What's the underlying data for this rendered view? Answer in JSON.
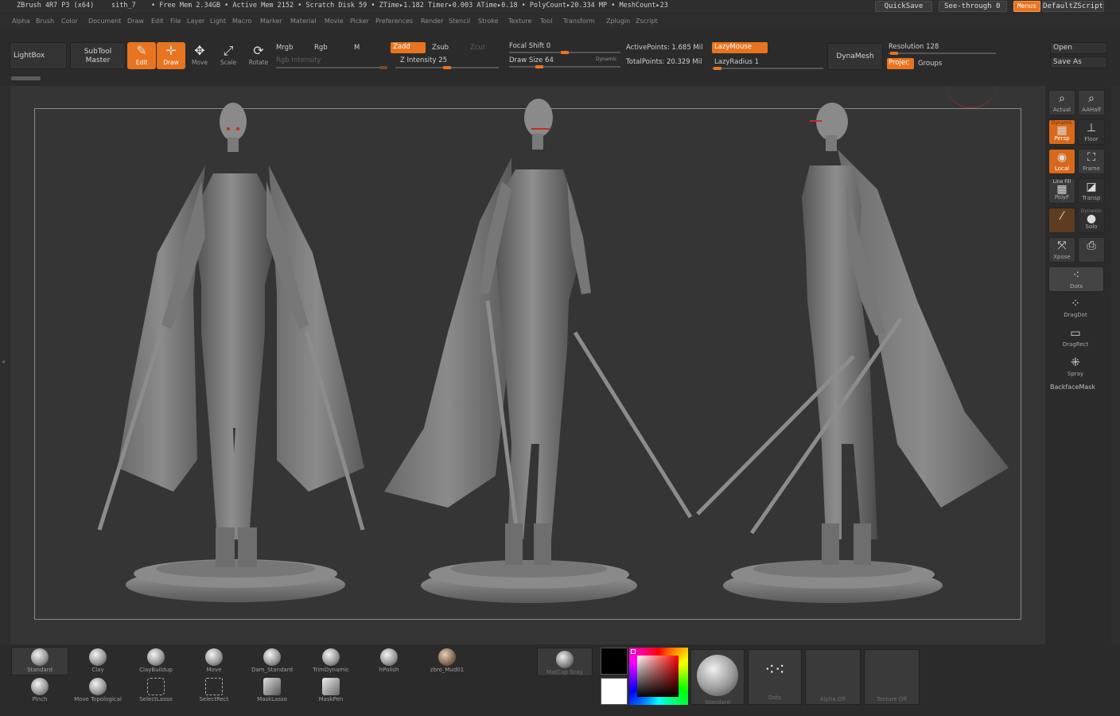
{
  "titlebar": {
    "app": "ZBrush 4R7 P3 (x64)",
    "doc": "sith_7",
    "status": "• Free Mem 2.34GB • Active Mem 2152 • Scratch Disk 59 • ZTime▸1.182 Timer▸0.003 ATime▸0.18 • PolyCount▸20.334 MP • MeshCount▸23",
    "quicksave": "QuickSave",
    "see_through": "See-through  0",
    "menus": "Menus",
    "default_script": "DefaultZScript"
  },
  "menus": [
    "Alpha",
    "Brush",
    "Color",
    "Document",
    "Draw",
    "Edit",
    "File",
    "Layer",
    "Light",
    "Macro",
    "Marker",
    "Material",
    "Movie",
    "Picker",
    "Preferences",
    "Render",
    "Stencil",
    "Stroke",
    "Texture",
    "Tool",
    "Transform",
    "Zplugin",
    "Zscript"
  ],
  "toolbar": {
    "lightbox": "LightBox",
    "subtool_master_1": "SubTool",
    "subtool_master_2": "Master",
    "edit": "Edit",
    "draw": "Draw",
    "move": "Move",
    "scale": "Scale",
    "rotate": "Rotate",
    "mrgb": "Mrgb",
    "rgb": "Rgb",
    "m": "M",
    "rgb_intensity": "Rgb  Intensity",
    "zadd": "Zadd",
    "zsub": "Zsub",
    "zcut": "Zcut",
    "z_intensity": "Z Intensity 25",
    "focal_shift": "Focal Shift 0",
    "draw_size": "Draw Size 64",
    "dynamic": "Dynamic",
    "active_points": "ActivePoints: 1.685 Mil",
    "total_points": "TotalPoints: 20.329 Mil",
    "lazymouse": "LazyMouse",
    "lazyradius": "LazyRadius 1",
    "dynamesh": "DynaMesh",
    "resolution": "Resolution 128",
    "project": "Projec",
    "groups": "Groups",
    "open": "Open",
    "save_as": "Save As"
  },
  "right_shelf": {
    "actual": "Actual",
    "aahalf": "AAHalf",
    "dynamic": "Dynamic",
    "persp": "Persp",
    "floor": "Floor",
    "local": "Local",
    "frame": "Frame",
    "line_fill": "Line Fill",
    "polyf": "PolyF",
    "transp": "Transp",
    "dynamic2": "Dynamic",
    "solo": "Solo",
    "xpose": "Xpose",
    "dots": "Dots",
    "dragdot": "DragDot",
    "dragrect": "DragRect",
    "spray": "Spray",
    "backfacemask": "BackfaceMask"
  },
  "brushes_row1": [
    "Standard",
    "Clay",
    "ClayBuildup",
    "Move",
    "Dam_Standard",
    "TrimDynamic",
    "hPolish",
    "zbro_Mud01"
  ],
  "brushes_row2": [
    "Pinch",
    "Move  Topological",
    "SelectLasso",
    "SelectRect",
    "MaskLasso",
    "MaskPen"
  ],
  "tray": {
    "matcap": "MatCap  Gray",
    "standard": "Standard",
    "dots": "Dots",
    "alpha_off": "Alpha  Off",
    "texture_off": "Texture  Off"
  },
  "colors": {
    "accent": "#e8741f",
    "background": "#2b2b2b",
    "viewport": "#353535",
    "main_color": "#000000",
    "secondary_color": "#ffffff"
  }
}
